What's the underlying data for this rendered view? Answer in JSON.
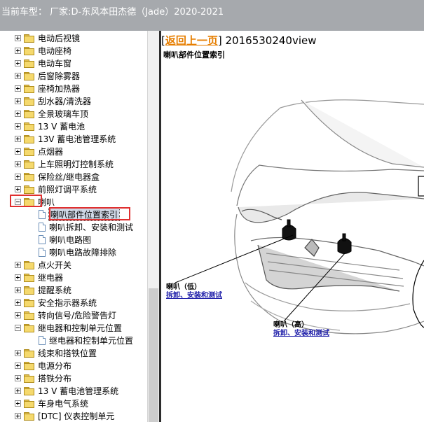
{
  "window": {
    "title": "当前车型：  厂家:D-东风本田杰德（Jade）2020-2021"
  },
  "tree": {
    "items": [
      {
        "label": "电动后视镜",
        "type": "folder",
        "state": "collapsed",
        "level": 0
      },
      {
        "label": "电动座椅",
        "type": "folder",
        "state": "collapsed",
        "level": 0
      },
      {
        "label": "电动车窗",
        "type": "folder",
        "state": "collapsed",
        "level": 0
      },
      {
        "label": "后窗除雾器",
        "type": "folder",
        "state": "collapsed",
        "level": 0
      },
      {
        "label": "座椅加热器",
        "type": "folder",
        "state": "collapsed",
        "level": 0
      },
      {
        "label": "刮水器/清洗器",
        "type": "folder",
        "state": "collapsed",
        "level": 0
      },
      {
        "label": "全景玻璃车顶",
        "type": "folder",
        "state": "collapsed",
        "level": 0
      },
      {
        "label": "13 V 蓄电池",
        "type": "folder",
        "state": "collapsed",
        "level": 0
      },
      {
        "label": "13V 蓄电池管理系统",
        "type": "folder",
        "state": "collapsed",
        "level": 0
      },
      {
        "label": "点烟器",
        "type": "folder",
        "state": "collapsed",
        "level": 0
      },
      {
        "label": "上车照明灯控制系统",
        "type": "folder",
        "state": "collapsed",
        "level": 0
      },
      {
        "label": "保险丝/继电器盒",
        "type": "folder",
        "state": "collapsed",
        "level": 0
      },
      {
        "label": "前照灯调平系统",
        "type": "folder",
        "state": "collapsed",
        "level": 0
      },
      {
        "label": "喇叭",
        "type": "folder",
        "state": "expanded",
        "level": 0
      },
      {
        "label": "喇叭部件位置索引",
        "type": "doc",
        "level": 1,
        "selected": true
      },
      {
        "label": "喇叭拆卸、安装和测试",
        "type": "doc",
        "level": 1
      },
      {
        "label": "喇叭电路图",
        "type": "doc",
        "level": 1
      },
      {
        "label": "喇叭电路故障排除",
        "type": "doc",
        "level": 1
      },
      {
        "label": "点火开关",
        "type": "folder",
        "state": "collapsed",
        "level": 0
      },
      {
        "label": "继电器",
        "type": "folder",
        "state": "collapsed",
        "level": 0
      },
      {
        "label": "提醒系统",
        "type": "folder",
        "state": "collapsed",
        "level": 0
      },
      {
        "label": "安全指示器系统",
        "type": "folder",
        "state": "collapsed",
        "level": 0
      },
      {
        "label": "转向信号/危险警告灯",
        "type": "folder",
        "state": "collapsed",
        "level": 0
      },
      {
        "label": "继电器和控制单元位置",
        "type": "folder",
        "state": "expanded",
        "level": 0
      },
      {
        "label": "继电器和控制单元位置",
        "type": "doc",
        "level": 1
      },
      {
        "label": "线束和搭铁位置",
        "type": "folder",
        "state": "collapsed",
        "level": 0
      },
      {
        "label": "电源分布",
        "type": "folder",
        "state": "collapsed",
        "level": 0
      },
      {
        "label": "搭铁分布",
        "type": "folder",
        "state": "collapsed",
        "level": 0
      },
      {
        "label": "13 V 蓄电池管理系统",
        "type": "folder",
        "state": "collapsed",
        "level": 0
      },
      {
        "label": "车身电气系统",
        "type": "folder",
        "state": "collapsed",
        "level": 0
      },
      {
        "label": "[DTC] 仪表控制单元",
        "type": "folder",
        "state": "collapsed",
        "level": 0
      }
    ]
  },
  "content": {
    "back_label": "返回上一页",
    "bracket_open": "[",
    "bracket_close": "]",
    "page_id": "2016530240view",
    "subtitle": "喇叭部件位置索引",
    "callout_low": {
      "label": "喇叭（低）",
      "link": "拆卸、安装和测试"
    },
    "callout_high": {
      "label": "喇叭（高）",
      "link": "拆卸、安装和测试"
    }
  },
  "colors": {
    "titlebar": "#a6a9ad",
    "back_link": "#e67e00",
    "callout_link": "#1c1ca8",
    "highlight_box": "#e03030"
  }
}
